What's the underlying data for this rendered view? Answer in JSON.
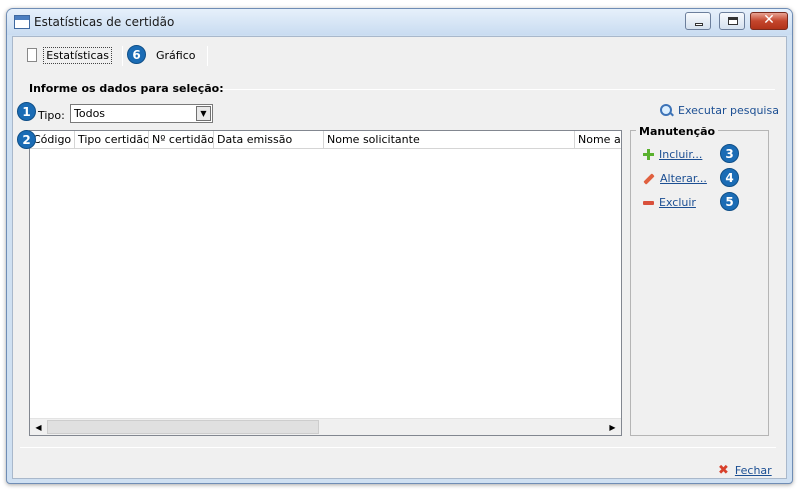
{
  "window": {
    "title": "Estatísticas de certidão"
  },
  "tabs": [
    {
      "label": "Estatísticas",
      "callout": ""
    },
    {
      "label": "Gráfico",
      "callout": "6"
    }
  ],
  "selection": {
    "group_label": "Informe os dados para seleção:",
    "tipo_label": "Tipo:",
    "tipo_value": "Todos",
    "callout": "1"
  },
  "search": {
    "label": "Executar pesquisa"
  },
  "grid": {
    "callout": "2",
    "columns": [
      "Código",
      "Tipo certidão",
      "Nº certidão",
      "Data emissão",
      "Nome solicitante",
      "Nome ap"
    ]
  },
  "maintenance": {
    "title": "Manutenção",
    "items": [
      {
        "label": "Incluir...",
        "callout": "3",
        "icon": "plus-icon"
      },
      {
        "label": "Alterar...",
        "callout": "4",
        "icon": "pencil-icon"
      },
      {
        "label": "Excluir",
        "callout": "5",
        "icon": "minus-icon"
      }
    ]
  },
  "footer": {
    "close_label": "Fechar"
  }
}
